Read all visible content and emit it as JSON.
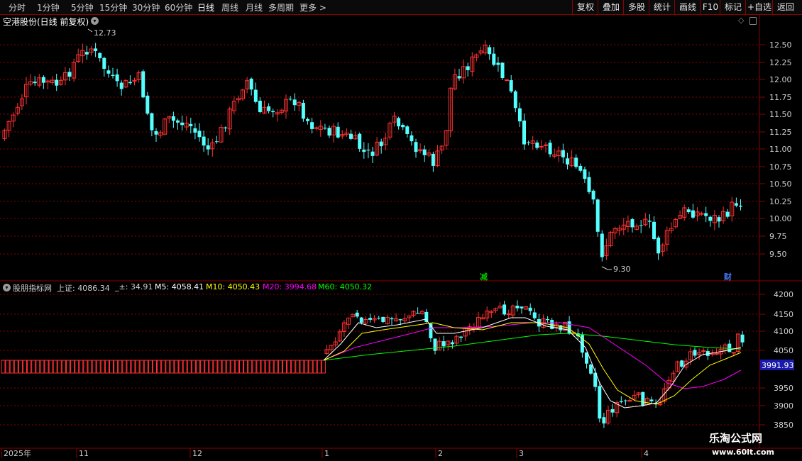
{
  "toolbar": {
    "periods": [
      "分时",
      "1分钟",
      "5分钟",
      "15分钟",
      "30分钟",
      "60分钟",
      "日线",
      "周线",
      "月线",
      "多周期",
      "更多 >"
    ],
    "active_period": "日线",
    "buttons": [
      "复权",
      "叠加",
      "多股",
      "统计",
      "画线",
      "F10",
      "标记",
      "+自选",
      "返回"
    ]
  },
  "main_chart": {
    "title": "空港股份(日线 前复权)",
    "high_label": "12.73",
    "low_label": "9.30",
    "y_ticks": [
      "12.50",
      "12.25",
      "12.00",
      "11.75",
      "11.50",
      "11.25",
      "11.00",
      "10.75",
      "10.50",
      "10.25",
      "10.00",
      "9.75",
      "9.50"
    ],
    "marker_reduce": "减",
    "marker_finance": "财"
  },
  "indicator": {
    "name": "股朋指标网",
    "index_label": "上证: 4086.34",
    "change_label": "_±: 34.91",
    "m5_label": "M5: 4058.41",
    "m10_label": "M10: 4050.43",
    "m20_label": "M20: 3994.68",
    "m60_label": "M60: 4050.32",
    "y_ticks": [
      "4200",
      "4150",
      "4100",
      "4050",
      "4000",
      "3950",
      "3900",
      "3850"
    ],
    "current_value": "3991.93"
  },
  "x_axis": {
    "labels": [
      "2025年",
      "11",
      "12",
      "1",
      "2",
      "3",
      "4"
    ]
  },
  "watermark": {
    "line1": "乐淘公式网",
    "line2": "www.60lt.com"
  },
  "colors": {
    "up": "#ff3232",
    "down": "#54ffff",
    "m5": "#ffffff",
    "m10": "#ffff00",
    "m20": "#ff00ff",
    "m60": "#00ff00",
    "grid": "#8b0000"
  }
}
